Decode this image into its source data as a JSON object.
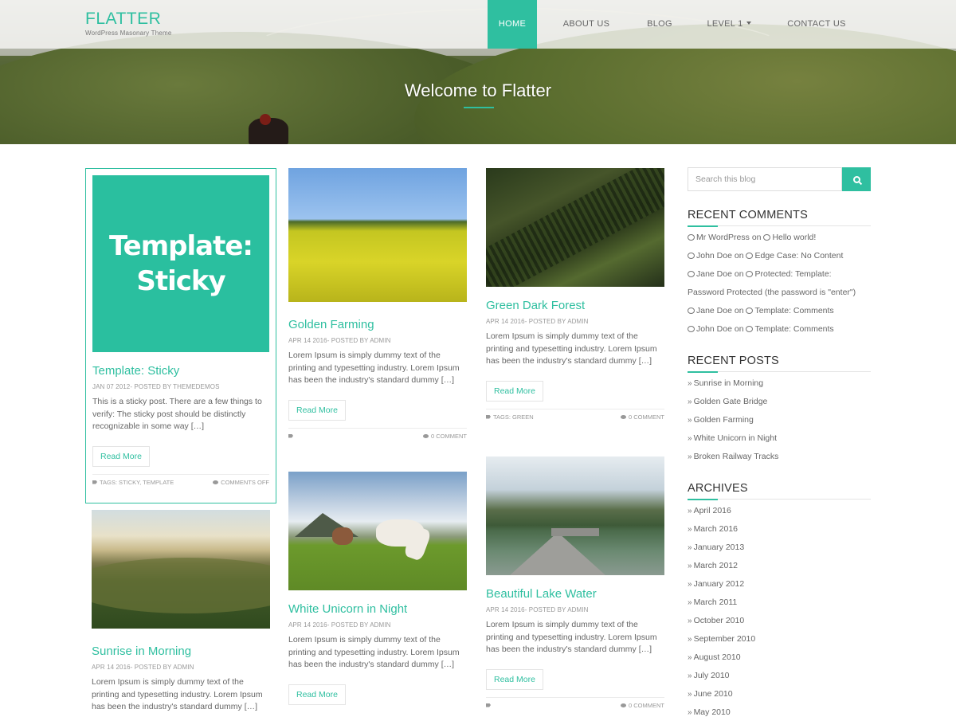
{
  "site": {
    "title": "FLATTER",
    "tagline": "WordPress Masonary Theme"
  },
  "nav": {
    "items": [
      {
        "label": "HOME",
        "active": true
      },
      {
        "label": "ABOUT US"
      },
      {
        "label": "BLOG"
      },
      {
        "label": "LEVEL 1"
      },
      {
        "label": "CONTACT US"
      }
    ]
  },
  "hero": {
    "title": "Welcome to Flatter"
  },
  "colors": {
    "accent": "#2fbfa0"
  },
  "posts": {
    "sticky": {
      "image_text_line1": "Template:",
      "image_text_line2": "Sticky",
      "title": "Template: Sticky",
      "meta": "JAN 07 2012- POSTED BY THEMEDEMOS",
      "excerpt": "This is a sticky post. There are a few things to verify: The sticky post should be distinctly recognizable in some way […]",
      "button": "Read More",
      "tags": "TAGS: STICKY, TEMPLATE",
      "comments": "COMMENTS OFF"
    },
    "golden": {
      "title": "Golden Farming",
      "meta": "APR 14 2016- POSTED BY ADMIN",
      "excerpt": "Lorem Ipsum is simply dummy text of the printing and typesetting industry. Lorem Ipsum has been the industry's standard dummy […]",
      "button": "Read More",
      "tags": "",
      "comments": "0 COMMENT"
    },
    "forest": {
      "title": "Green Dark Forest",
      "meta": "APR 14 2016- POSTED BY ADMIN",
      "excerpt": "Lorem Ipsum is simply dummy text of the printing and typesetting industry. Lorem Ipsum has been the industry's standard dummy […]",
      "button": "Read More",
      "tags": "TAGS: GREEN",
      "comments": "0 COMMENT"
    },
    "sunrise": {
      "title": "Sunrise in Morning",
      "meta": "APR 14 2016- POSTED BY ADMIN",
      "excerpt": "Lorem Ipsum is simply dummy text of the printing and typesetting industry. Lorem Ipsum has been the industry's standard dummy […]"
    },
    "unicorn": {
      "title": "White Unicorn in Night",
      "meta": "APR 14 2016- POSTED BY ADMIN",
      "excerpt": "Lorem Ipsum is simply dummy text of the printing and typesetting industry. Lorem Ipsum has been the industry's standard dummy […]",
      "button": "Read More"
    },
    "lake": {
      "title": "Beautiful Lake Water",
      "meta": "APR 14 2016- POSTED BY ADMIN",
      "excerpt": "Lorem Ipsum is simply dummy text of the printing and typesetting industry. Lorem Ipsum has been the industry's standard dummy […]",
      "button": "Read More",
      "comments": "0 COMMENT"
    }
  },
  "sidebar": {
    "search_placeholder": "Search this blog",
    "recent_comments": {
      "title": "RECENT COMMENTS",
      "items": [
        {
          "author": "Mr WordPress",
          "on": "on",
          "post": "Hello world!"
        },
        {
          "author": "John Doe",
          "on": "on",
          "post": "Edge Case: No Content"
        },
        {
          "author": "Jane Doe",
          "on": "on",
          "post": "Protected: Template:",
          "post_cont": "Password Protected (the password is \"enter\")"
        },
        {
          "author": "Jane Doe",
          "on": "on",
          "post": "Template: Comments"
        },
        {
          "author": "John Doe",
          "on": "on",
          "post": "Template: Comments"
        }
      ]
    },
    "recent_posts": {
      "title": "RECENT POSTS",
      "items": [
        "Sunrise in Morning",
        "Golden Gate Bridge",
        "Golden Farming",
        "White Unicorn in Night",
        "Broken Railway Tracks"
      ]
    },
    "archives": {
      "title": "ARCHIVES",
      "items": [
        "April 2016",
        "March 2016",
        "January 2013",
        "March 2012",
        "January 2012",
        "March 2011",
        "October 2010",
        "September 2010",
        "August 2010",
        "July 2010",
        "June 2010",
        "May 2010"
      ]
    }
  }
}
